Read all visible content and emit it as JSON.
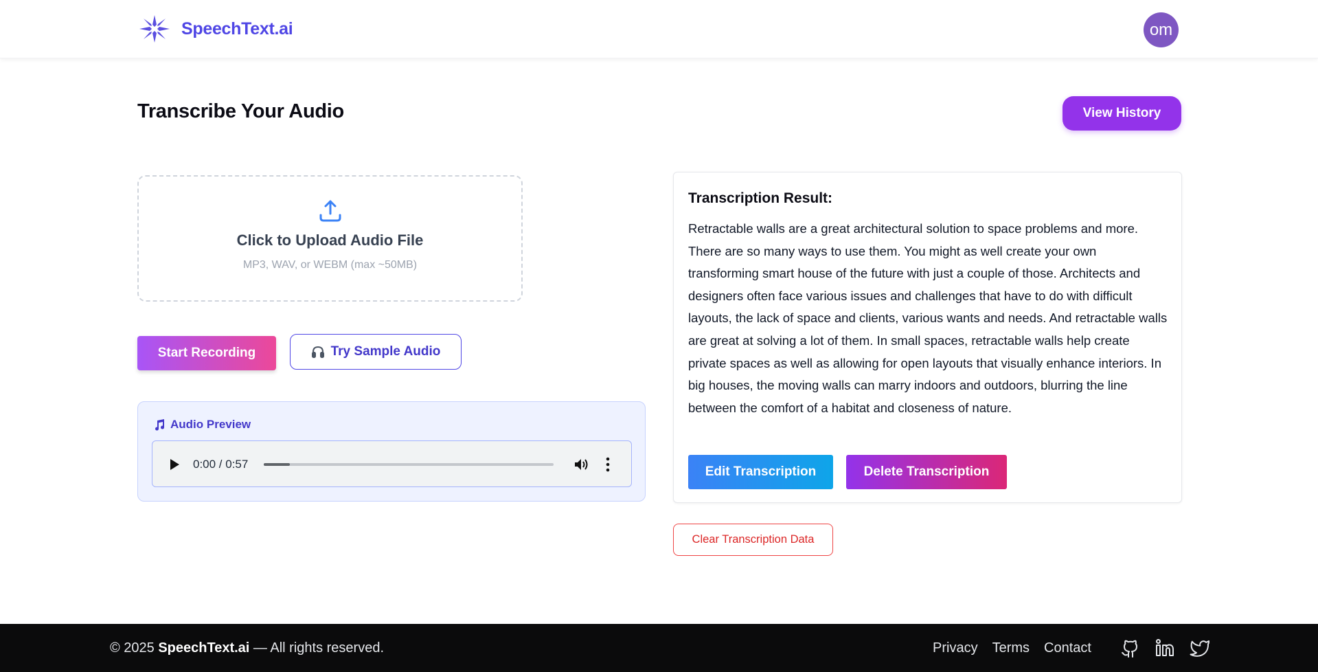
{
  "brand": {
    "name": "SpeechText.ai"
  },
  "user": {
    "initials": "om"
  },
  "page": {
    "title": "Transcribe Your Audio",
    "history_button": "View History"
  },
  "upload": {
    "title": "Click to Upload Audio File",
    "hint": "MP3, WAV, or WEBM (max ~50MB)",
    "icon": "upload-icon"
  },
  "actions": {
    "record_button": "Start Recording",
    "sample_button": "Try Sample Audio"
  },
  "audio_preview": {
    "heading": "Audio Preview",
    "time_display": "0:00 / 0:57",
    "progress_fraction": 0.09
  },
  "result": {
    "heading": "Transcription Result:",
    "text": "Retractable walls are a great architectural solution to space problems and more. There are so many ways to use them. You might as well create your own transforming smart house of the future with just a couple of those. Architects and designers often face various issues and challenges that have to do with difficult layouts, the lack of space and clients, various wants and needs. And retractable walls are great at solving a lot of them. In small spaces, retractable walls help create private spaces as well as allowing for open layouts that visually enhance interiors. In big houses, the moving walls can marry indoors and outdoors, blurring the line between the comfort of a habitat and closeness of nature.",
    "edit_button": "Edit Transcription",
    "delete_button": "Delete Transcription",
    "clear_button": "Clear Transcription Data"
  },
  "footer": {
    "copyright_prefix": "© 2025 ",
    "copyright_brand": "SpeechText.ai",
    "copyright_suffix": " — All rights reserved.",
    "links": [
      "Privacy",
      "Terms",
      "Contact"
    ],
    "socials": [
      "github-icon",
      "linkedin-icon",
      "twitter-icon"
    ]
  },
  "colors": {
    "brand": "#4f46e5",
    "accent_purple": "#9333ea",
    "accent_pink": "#ec4899",
    "danger": "#dc2626",
    "footer_bg": "#0b0b0c"
  }
}
